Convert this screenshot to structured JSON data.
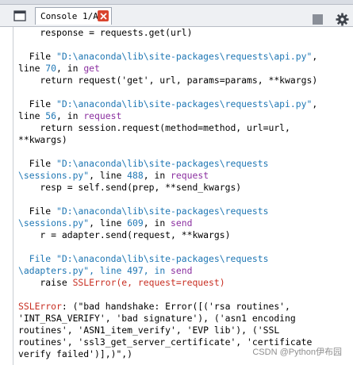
{
  "tab": {
    "label": "Console 1/A"
  },
  "icons": {
    "console": "console-window-icon",
    "close": "close-icon",
    "stop": "stop-icon",
    "settings": "gear-icon"
  },
  "colors": {
    "blue": "#1f77b4",
    "purple": "#8b2fa0",
    "red": "#c82f23",
    "close_button": "#d9452f"
  },
  "console": {
    "l1": "    response = requests.get(url)",
    "l2a": "  File ",
    "l2b": "\"D:\\anaconda\\lib\\site-packages\\requests\\api.py\"",
    "l2c": ",",
    "l3a": "line ",
    "l3b": "70",
    "l3c": ", in ",
    "l3d": "get",
    "l4": "    return request('get', url, params=params, **kwargs)",
    "l5a": "  File ",
    "l5b": "\"D:\\anaconda\\lib\\site-packages\\requests\\api.py\"",
    "l5c": ",",
    "l6a": "line ",
    "l6b": "56",
    "l6c": ", in ",
    "l6d": "request",
    "l7": "    return session.request(method=method, url=url,",
    "l8": "**kwargs)",
    "l9a": "  File ",
    "l9b": "\"D:\\anaconda\\lib\\site-packages\\requests",
    "l10a": "\\sessions.py\"",
    "l10b": ", line ",
    "l10c": "488",
    "l10d": ", in ",
    "l10e": "request",
    "l11": "    resp = self.send(prep, **send_kwargs)",
    "l12a": "  File ",
    "l12b": "\"D:\\anaconda\\lib\\site-packages\\requests",
    "l13a": "\\sessions.py\"",
    "l13b": ", line ",
    "l13c": "609",
    "l13d": ", in ",
    "l13e": "send",
    "l14": "    r = adapter.send(request, **kwargs)",
    "l15a": "  File ",
    "l15b": "\"D:\\anaconda\\lib\\site-packages\\requests",
    "l16a": "\\adapters.py\"",
    "l16b": ", line ",
    "l16c": "497",
    "l16d": ", in ",
    "l16e": "send",
    "l17a": "    raise ",
    "l17b": "SSLError(e, request=request)",
    "l18a": "SSLError",
    "l18b": ": (\"bad handshake: Error([('rsa routines',",
    "l19": "'INT_RSA_VERIFY', 'bad signature'), ('asn1 encoding",
    "l20": "routines', 'ASN1_item_verify', 'EVP lib'), ('SSL",
    "l21": "routines', 'ssl3_get_server_certificate', 'certificate",
    "l22": "verify failed')],)\",)"
  },
  "watermark": "CSDN @Python伊布园"
}
